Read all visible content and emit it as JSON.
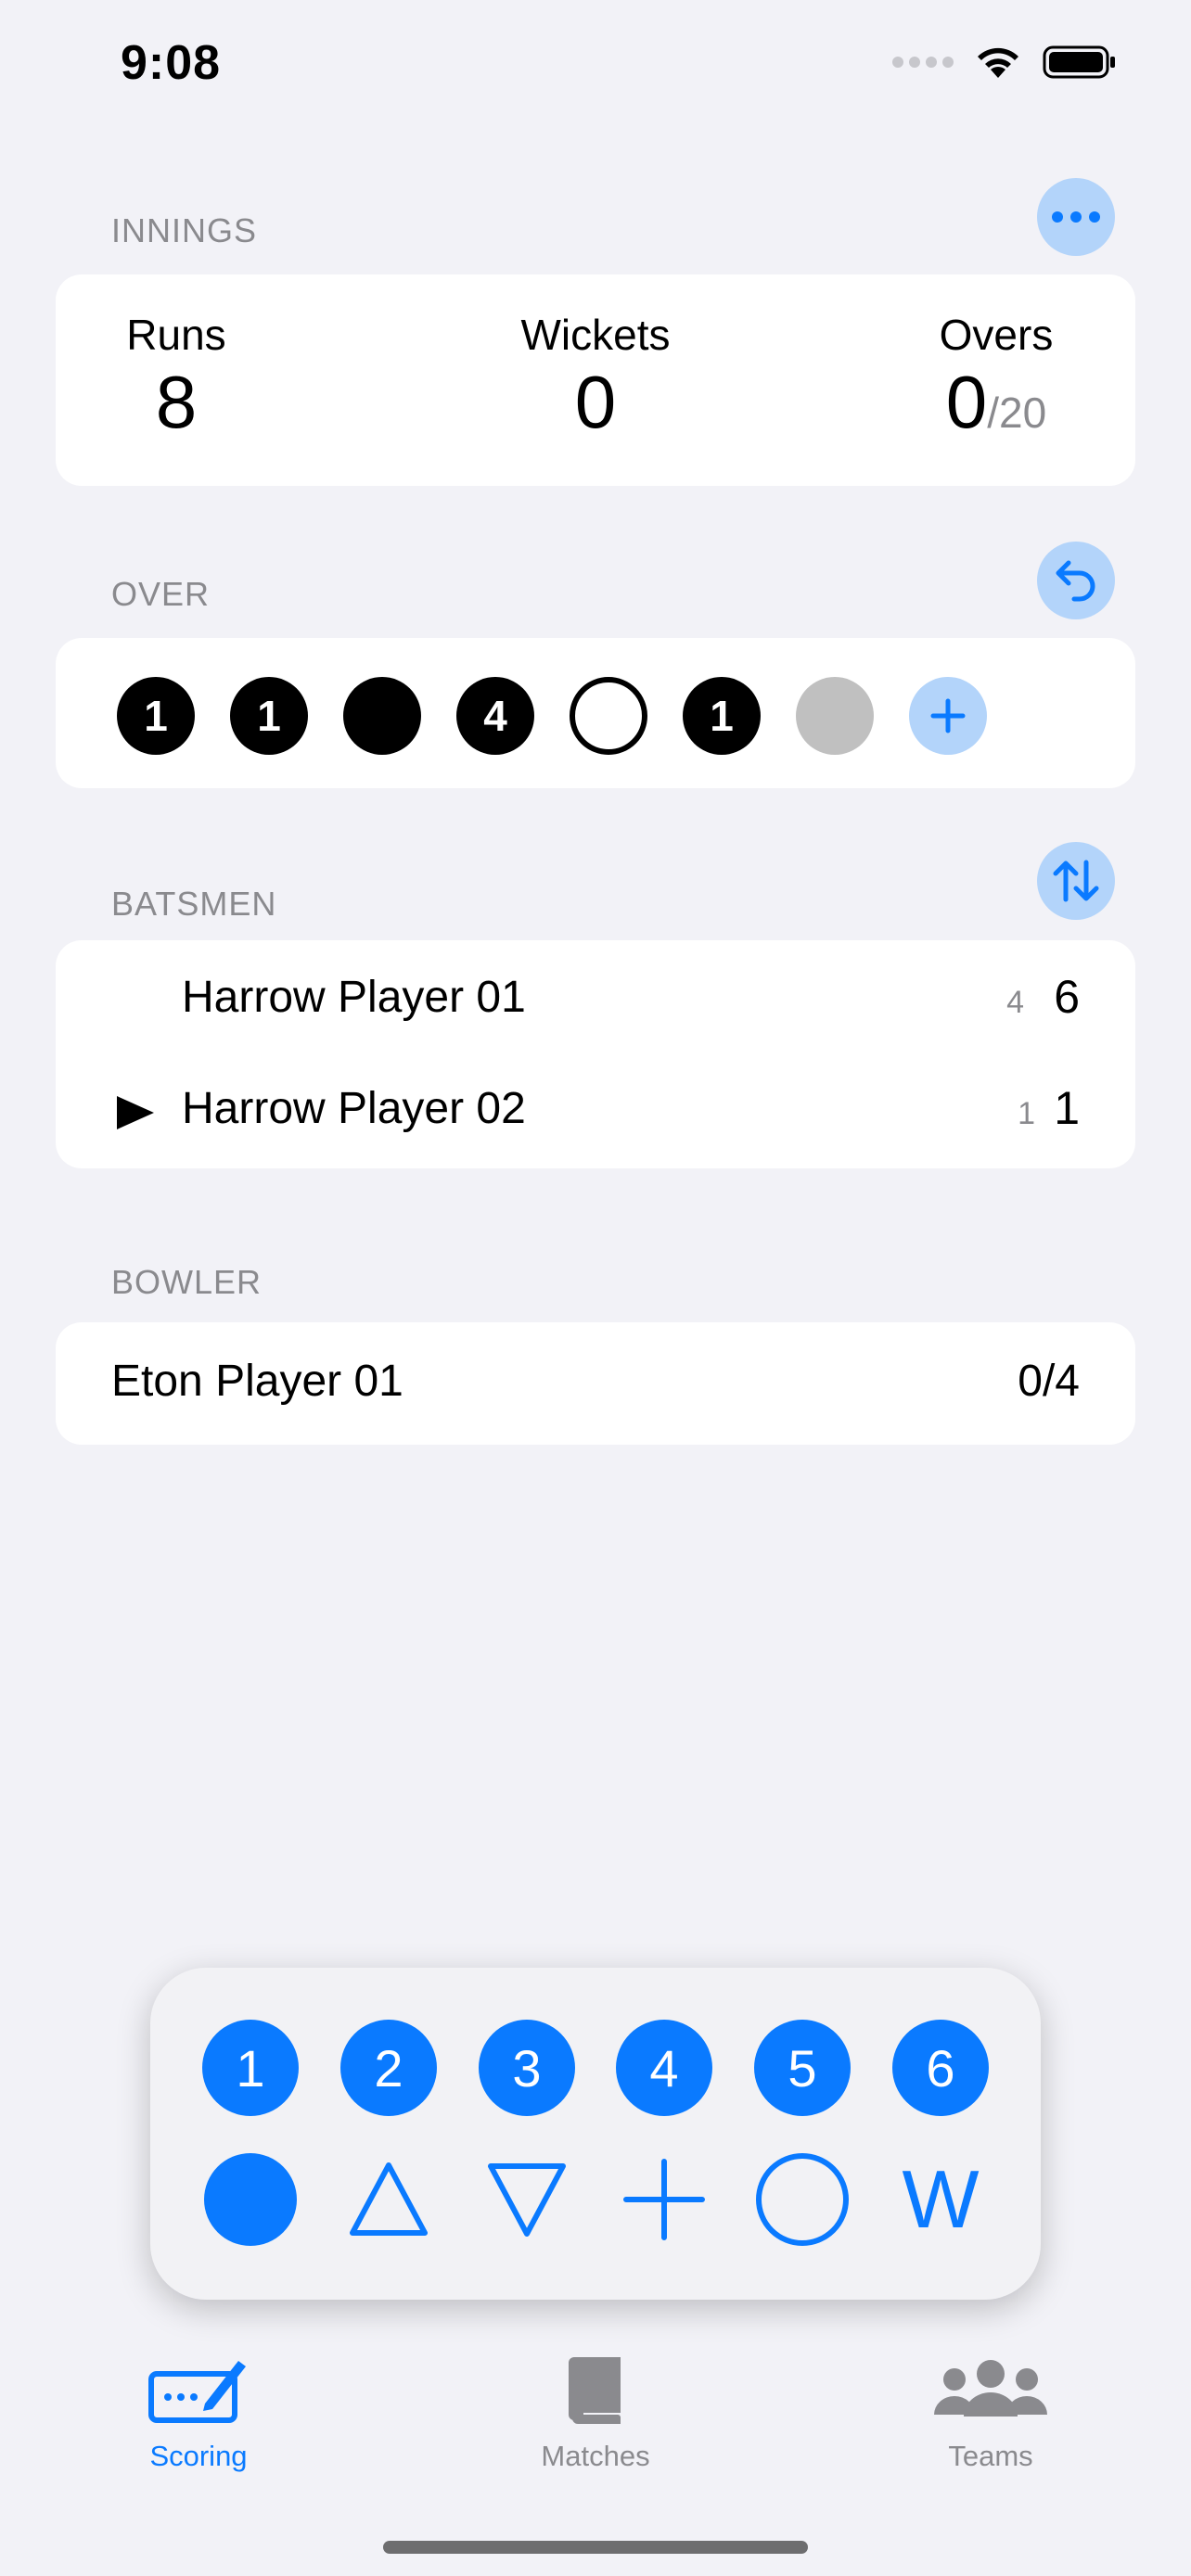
{
  "status_bar": {
    "time": "9:08"
  },
  "innings": {
    "section_label": "INNINGS",
    "runs_label": "Runs",
    "runs": "8",
    "wickets_label": "Wickets",
    "wickets": "0",
    "overs_label": "Overs",
    "overs": "0",
    "overs_total": "/20"
  },
  "over": {
    "section_label": "OVER",
    "balls": [
      "1",
      "1",
      "",
      "4",
      "",
      "1",
      ""
    ]
  },
  "batsmen": {
    "section_label": "BATSMEN",
    "rows": [
      {
        "name": "Harrow Player 01",
        "balls": "4",
        "runs": "6",
        "on_strike": false
      },
      {
        "name": "Harrow Player 02",
        "balls": "1",
        "runs": "1",
        "on_strike": true
      }
    ]
  },
  "bowler": {
    "section_label": "BOWLER",
    "name": "Eton Player 01",
    "figures": "0/4"
  },
  "keypad": {
    "numbers": [
      "1",
      "2",
      "3",
      "4",
      "5",
      "6"
    ],
    "wicket_label": "W",
    "accent": "#0a7aff"
  },
  "tab_bar": {
    "tabs": [
      {
        "label": "Scoring",
        "icon": "scoring-icon",
        "active": true
      },
      {
        "label": "Matches",
        "icon": "book-icon",
        "active": false
      },
      {
        "label": "Teams",
        "icon": "people-icon",
        "active": false
      }
    ]
  }
}
